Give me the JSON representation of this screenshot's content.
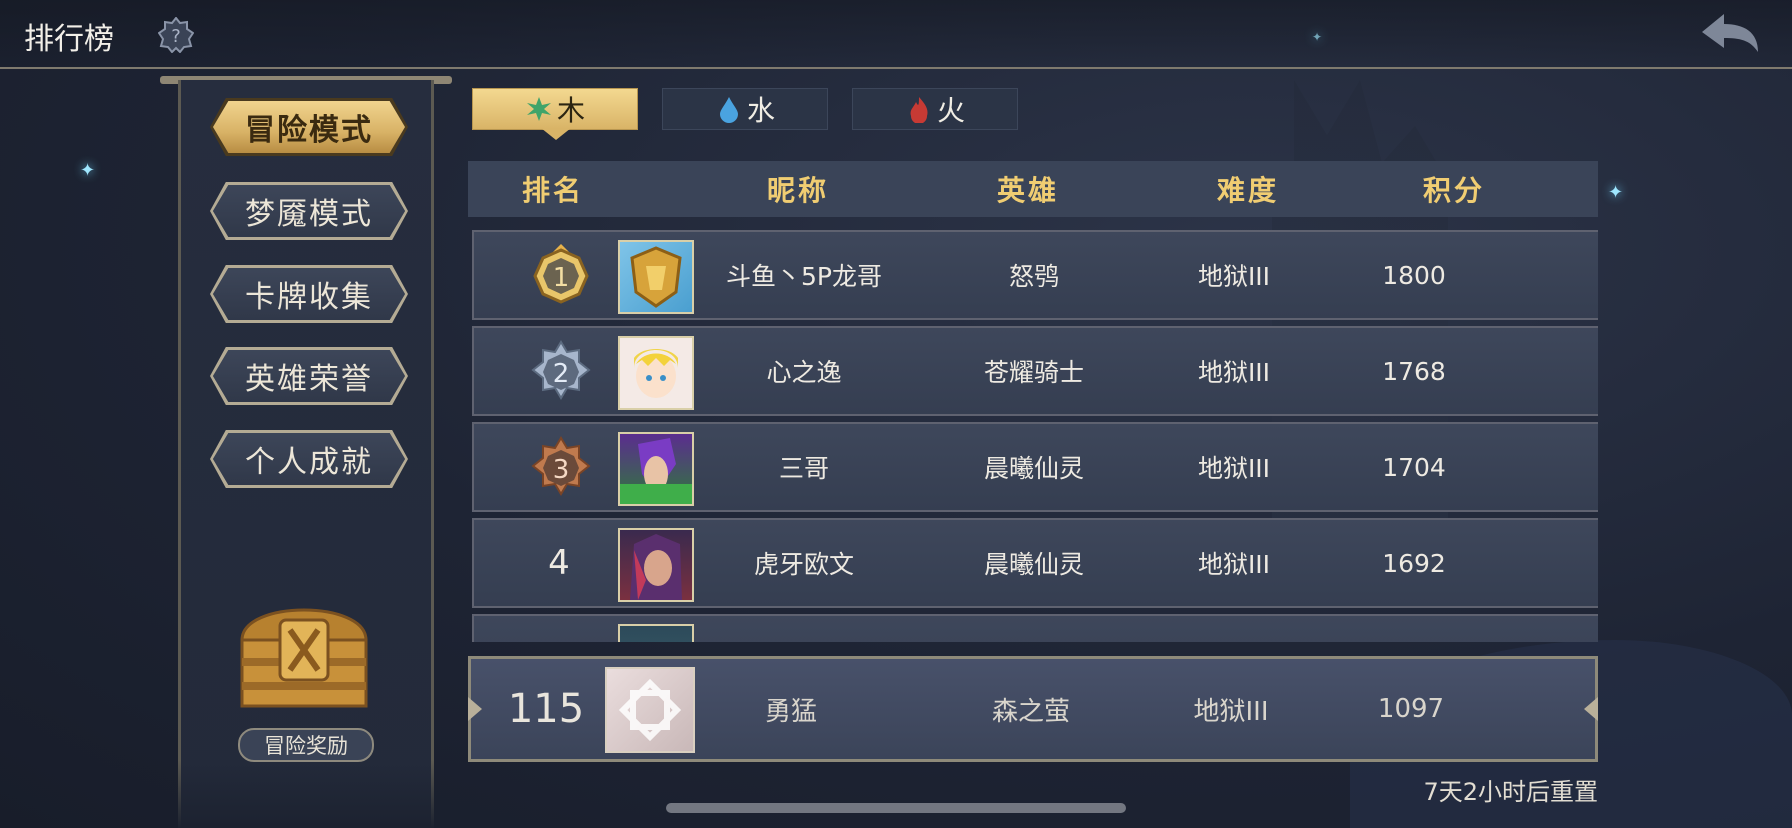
{
  "header": {
    "title": "排行榜",
    "help_icon": "help-question-icon",
    "back_icon": "back-arrow-icon"
  },
  "sidebar": {
    "modes": [
      {
        "label": "冒险模式",
        "active": true
      },
      {
        "label": "梦魇模式",
        "active": false
      },
      {
        "label": "卡牌收集",
        "active": false
      },
      {
        "label": "英雄荣誉",
        "active": false
      },
      {
        "label": "个人成就",
        "active": false
      }
    ],
    "reward_label": "冒险奖励",
    "reward_icon": "treasure-chest-icon"
  },
  "element_tabs": [
    {
      "label": "木",
      "icon": "leaf-icon",
      "color": "#3fa46a",
      "active": true
    },
    {
      "label": "水",
      "icon": "water-drop-icon",
      "color": "#4aa3e0",
      "active": false
    },
    {
      "label": "火",
      "icon": "flame-icon",
      "color": "#c73a34",
      "active": false
    }
  ],
  "table": {
    "headers": [
      "排名",
      "昵称",
      "英雄",
      "难度",
      "积分"
    ],
    "rows": [
      {
        "rank": "1",
        "nickname": "斗鱼丶5P龙哥",
        "hero": "怒鸮",
        "difficulty": "地狱III",
        "score": "1800",
        "badge": "gold"
      },
      {
        "rank": "2",
        "nickname": "心之逸",
        "hero": "苍耀骑士",
        "difficulty": "地狱III",
        "score": "1768",
        "badge": "silver"
      },
      {
        "rank": "3",
        "nickname": "三哥",
        "hero": "晨曦仙灵",
        "difficulty": "地狱III",
        "score": "1704",
        "badge": "bronze"
      },
      {
        "rank": "4",
        "nickname": "虎牙欧文",
        "hero": "晨曦仙灵",
        "difficulty": "地狱III",
        "score": "1692",
        "badge": "none"
      }
    ]
  },
  "self_row": {
    "rank": "115",
    "nickname": "勇猛",
    "hero": "森之萤",
    "difficulty": "地狱III",
    "score": "1097"
  },
  "reset_text": "7天2小时后重置",
  "colors": {
    "accent_gold": "#f0cd72",
    "background": "#1e2434",
    "panel": "#3a4458"
  }
}
